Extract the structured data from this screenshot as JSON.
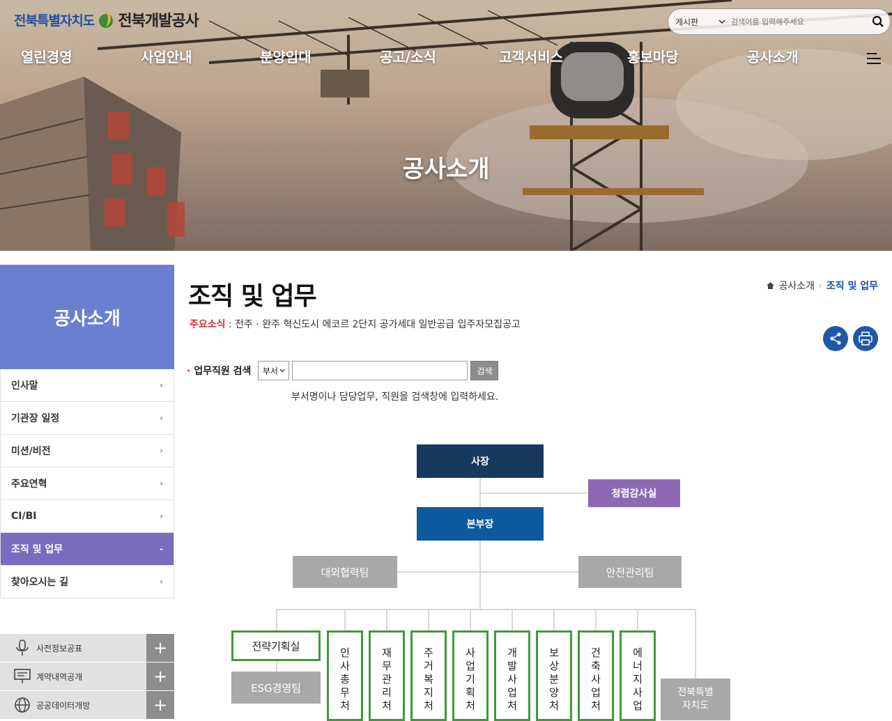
{
  "header": {
    "logo_text1": "전북특별자치도",
    "logo_text2": "전북개발공사",
    "search_select": "게시판",
    "search_placeholder": "검색어를 입력해주세요"
  },
  "nav": [
    "열린경영",
    "사업안내",
    "분양임대",
    "공고/소식",
    "고객서비스",
    "홍보마당",
    "공사소개"
  ],
  "hero": {
    "title": "공사소개"
  },
  "sidebar": {
    "title": "공사소개",
    "items": [
      {
        "label": "인사말",
        "mark": "›"
      },
      {
        "label": "기관장 일정",
        "mark": "›"
      },
      {
        "label": "미션/비전",
        "mark": "›"
      },
      {
        "label": "주요연혁",
        "mark": "›"
      },
      {
        "label": "CI/BI",
        "mark": "›"
      },
      {
        "label": "조직 및 업무",
        "mark": "-"
      },
      {
        "label": "찾아오시는 길",
        "mark": "›"
      }
    ],
    "quick": [
      {
        "label": "사전정보공표",
        "icon": "microphone-icon"
      },
      {
        "label": "계약내역공개",
        "icon": "presentation-board-icon"
      },
      {
        "label": "공공데이터개방",
        "icon": "globe-icon"
      }
    ]
  },
  "content": {
    "title": "조직 및 업무",
    "breadcrumb": {
      "home": "공사소개",
      "current": "조직 및 업무"
    },
    "notice_label": "주요소식",
    "notice_text": " : 전주 · 완주 혁신도시 에코르 2단지 공가세대 일반공급 입주자모집공고",
    "search_label": "업무직원 검색",
    "search_select": "부서",
    "search_button": "검색",
    "search_hint": "부서명이나 담당업무, 직원을 검색창에 입력하세요."
  },
  "org": {
    "ceo": "사장",
    "audit": "청렴감사실",
    "gm": "본부장",
    "team_left": "대외협력팀",
    "team_right": "안전관리팀",
    "strategy": "전략기획실",
    "esg": "ESG경영팀",
    "departments": [
      {
        "label": "인사총무처",
        "chars": [
          "인",
          "사",
          "총",
          "무",
          "처"
        ]
      },
      {
        "label": "재무관리처",
        "chars": [
          "재",
          "무",
          "관",
          "리",
          "처"
        ]
      },
      {
        "label": "주거복지처",
        "chars": [
          "주",
          "거",
          "복",
          "지",
          "처"
        ]
      },
      {
        "label": "사업기획처",
        "chars": [
          "사",
          "업",
          "기",
          "획",
          "처"
        ]
      },
      {
        "label": "개발사업처",
        "chars": [
          "개",
          "발",
          "사",
          "업",
          "처"
        ]
      },
      {
        "label": "보상분양처",
        "chars": [
          "보",
          "상",
          "분",
          "양",
          "처"
        ]
      },
      {
        "label": "건축사업처",
        "chars": [
          "건",
          "축",
          "사",
          "업",
          "처"
        ]
      },
      {
        "label": "에너지사업",
        "chars": [
          "에",
          "너",
          "지",
          "사",
          "업"
        ]
      }
    ],
    "jb_line1": "전북특별",
    "jb_line2": "자치도"
  }
}
